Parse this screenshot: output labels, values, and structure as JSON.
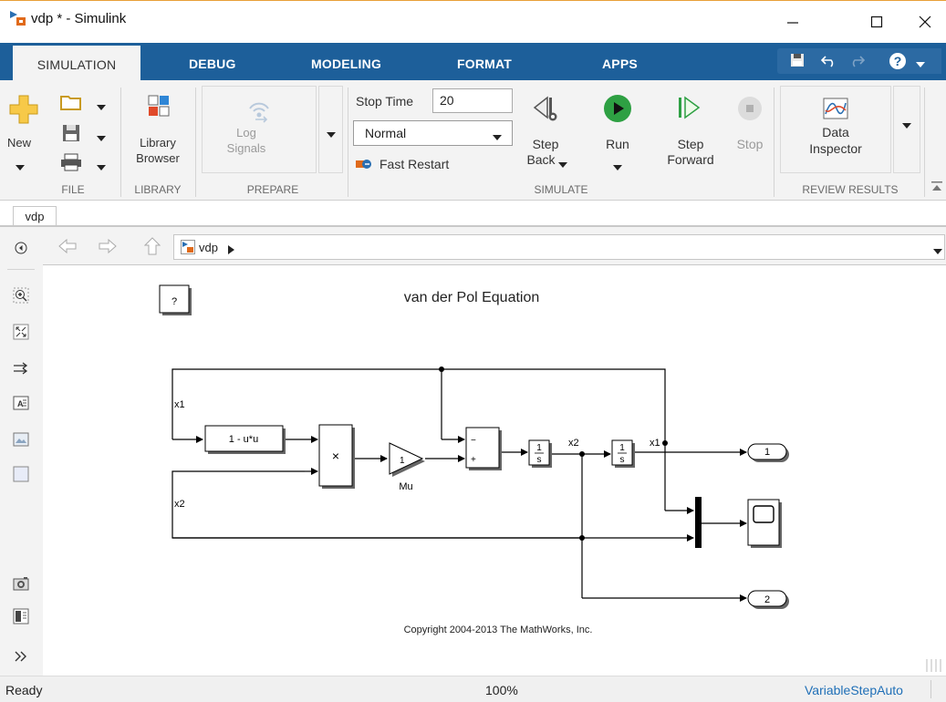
{
  "window": {
    "title": "vdp * - Simulink"
  },
  "tabs": [
    "SIMULATION",
    "DEBUG",
    "MODELING",
    "FORMAT",
    "APPS"
  ],
  "ribbon": {
    "file": {
      "new_label": "New",
      "section": "FILE"
    },
    "library": {
      "browser_line1": "Library",
      "browser_line2": "Browser",
      "section": "LIBRARY"
    },
    "prepare": {
      "log_line1": "Log",
      "log_line2": "Signals",
      "section": "PREPARE"
    },
    "simulate": {
      "stop_time_label": "Stop Time",
      "stop_time_value": "20",
      "mode_value": "Normal",
      "fast_restart_label": "Fast Restart",
      "step_back_line1": "Step",
      "step_back_line2": "Back",
      "run_label": "Run",
      "step_forward_line1": "Step",
      "step_forward_line2": "Forward",
      "stop_label": "Stop",
      "section": "SIMULATE"
    },
    "review": {
      "data_line1": "Data",
      "data_line2": "Inspector",
      "section": "REVIEW RESULTS"
    }
  },
  "editor": {
    "doc_tab": "vdp",
    "breadcrumb": "vdp"
  },
  "model": {
    "title": "van der Pol Equation",
    "help_block": "?",
    "fcn_block": "1 - u*u",
    "product_symbol": "×",
    "gain_value": "1",
    "gain_name": "Mu",
    "sum_minus": "−",
    "sum_plus": "+",
    "integrator_num": "1",
    "integrator_den": "s",
    "signal_x1": "x1",
    "signal_x2": "x2",
    "outport1": "1",
    "outport2": "2",
    "copyright": "Copyright 2004-2013 The MathWorks, Inc."
  },
  "status": {
    "left": "Ready",
    "zoom": "100%",
    "solver": "VariableStepAuto"
  },
  "colors": {
    "tabbar": "#1d5f9a",
    "ribbon_bg": "#f3f3f3",
    "solver_link": "#1f6fb7",
    "run_green": "#2ea043"
  }
}
